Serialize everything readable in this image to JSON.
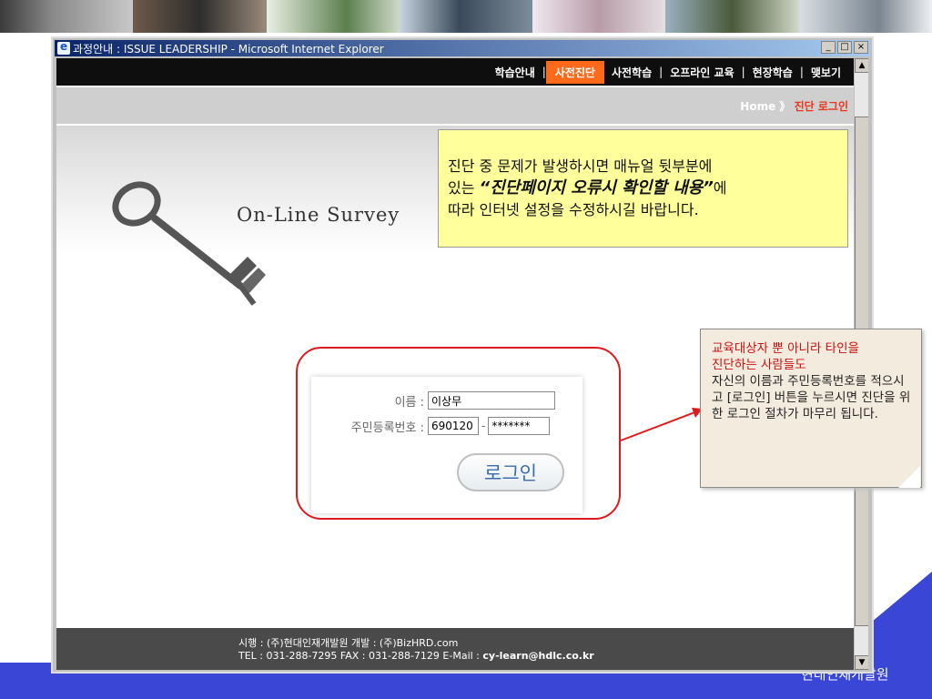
{
  "window": {
    "title": "과정안내 : ISSUE LEADERSHIP - Microsoft Internet Explorer",
    "buttons": [
      "_",
      "□",
      "×"
    ]
  },
  "nav": {
    "items": [
      {
        "label": "학습안내",
        "active": false
      },
      {
        "label": "사전진단",
        "active": true
      },
      {
        "label": "사전학습",
        "active": false
      },
      {
        "label": "오프라인 교육",
        "active": false
      },
      {
        "label": "현장학습",
        "active": false
      },
      {
        "label": "맺보기",
        "active": false
      }
    ],
    "separator": "|"
  },
  "breadcrumb": {
    "home": "Home",
    "sep": "》",
    "current": "진단 로그인"
  },
  "hero": {
    "title": "On-Line Survey"
  },
  "login": {
    "name_label": "이름 :",
    "name_value": "이상무",
    "id_label": "주민등록번호 :",
    "id_front": "690120",
    "id_dash": "-",
    "id_back": "*******",
    "button_label": "로그인"
  },
  "footer": {
    "line1": "시행 : (주)현대인재개발원   개발 : (주)BizHRD.com",
    "line2_prefix": "TEL : 031-288-7295   FAX : 031-288-7129   E-Mail : ",
    "email": "cy-learn@hdlc.co.kr"
  },
  "callout_yellow": {
    "line1": "진단 중 문제가 발생하시면 매뉴얼 뒷부분에",
    "line2_prefix": "있는 ",
    "line2_emph": "“진단페이지 오류시 확인할 내용”",
    "line2_suffix": "에",
    "line3": "따라 인터넷 설정을 수정하시길 바랍니다."
  },
  "note": {
    "highlight1": "교육대상자 뿐 아니라 타인을",
    "highlight2": "진단하는 사람들도",
    "body": "자신의 이름과 주민등록번호를 적으시고 [로그인] 버튼을 누르시면 진단을 위한 로그인 절차가 마무리 됩니다."
  },
  "corner": {
    "text": "현대인재개발원"
  },
  "colors": {
    "accent": "#ff6a1a",
    "callout": "#ffff9c",
    "ring": "#e0191c",
    "band": "#3a46d6"
  }
}
